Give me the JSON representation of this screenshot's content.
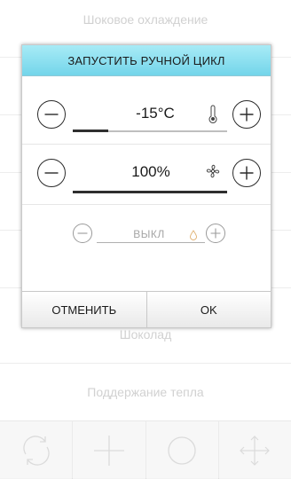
{
  "background_list": {
    "items": [
      {
        "label": "Шоковое охлаждение"
      },
      {
        "label": ""
      },
      {
        "label": ""
      },
      {
        "label": ""
      },
      {
        "label": ""
      },
      {
        "label": "Шоколад"
      },
      {
        "label": "Поддержание тепла"
      }
    ]
  },
  "bottom_bar": {
    "buttons": [
      {
        "icon": "refresh-icon"
      },
      {
        "icon": "plus-icon"
      },
      {
        "icon": "circle-icon"
      },
      {
        "icon": "move-arrows-icon"
      }
    ]
  },
  "dialog": {
    "title": "ЗАПУСТИТЬ РУЧНОЙ ЦИКЛ",
    "temperature": {
      "value": "-15°C",
      "icon": "thermometer-icon",
      "fill_fraction": 0.23
    },
    "fan": {
      "value": "100%",
      "icon": "fan-icon",
      "fill_fraction": 1.0
    },
    "humidity": {
      "value": "ВЫКЛ",
      "icon": "water-drop-icon",
      "fill_fraction": 0.0
    },
    "cancel_label": "ОТМЕНИТЬ",
    "ok_label": "OK",
    "accent_color": "#73d5ea"
  }
}
